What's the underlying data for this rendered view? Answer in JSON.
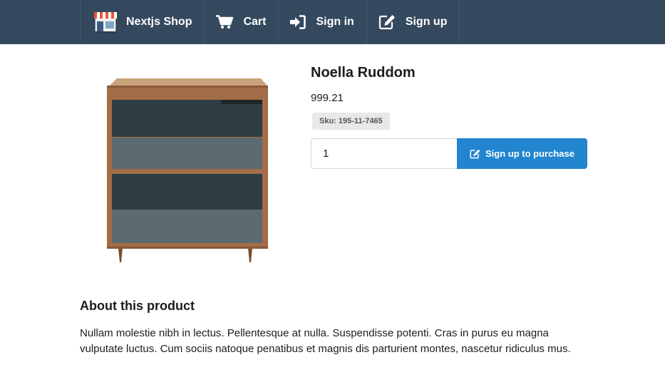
{
  "nav": {
    "brand": {
      "label": "Nextjs Shop",
      "icon": "shop-icon"
    },
    "items": [
      {
        "label": "Cart",
        "icon": "cart-icon"
      },
      {
        "label": "Sign in",
        "icon": "sign-in-icon"
      },
      {
        "label": "Sign up",
        "icon": "edit-icon"
      }
    ],
    "colors": {
      "background": "#34495e",
      "text": "#ffffff"
    }
  },
  "product": {
    "title": "Noella Ruddom",
    "price": "999.21",
    "sku": "Sku: 195-11-7465",
    "image_icon": "dresser-image"
  },
  "purchase": {
    "quantity": "1",
    "button_label": "Sign up to purchase",
    "button_icon": "edit-icon",
    "button_color": "#2185d0"
  },
  "about": {
    "heading": "About this product",
    "text": "Nullam molestie nibh in lectus. Pellentesque at nulla. Suspendisse potenti. Cras in purus eu magna vulputate luctus. Cum sociis natoque penatibus et magnis dis parturient montes, nascetur ridiculus mus."
  }
}
